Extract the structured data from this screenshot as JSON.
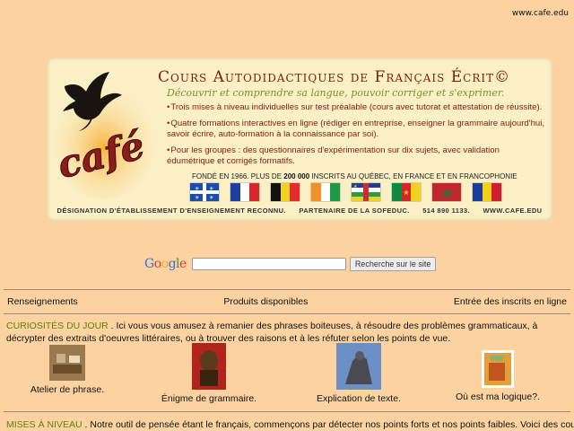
{
  "header": {
    "url": "www.cafe.edu"
  },
  "banner": {
    "logo_text": "café",
    "title": "Cours Autodidactiques de Français Écrit©",
    "subtitle": "Découvrir et comprendre sa langue, pouvoir corriger et s'exprimer.",
    "bullets": [
      "Trois mises à niveau individuelles sur test préalable (cours avec tutorat et attestation de réussite).",
      "Quatre formations interactives en ligne (rédiger en entreprise, enseigner la grammaire aujourd'hui, savoir écrire, auto-formation à la connaissance par soi).",
      "Pour les groupes : des questionnaires d'expérimentation sur dix sujets, avec validation édumétrique et corrigés formatifs."
    ],
    "founded_prefix": "FONDÉ EN 1966. PLUS DE ",
    "founded_count": "200 000",
    "founded_suffix": " INSCRITS AU QUÉBEC, EN FRANCE ET EN FRANCOPHONIE",
    "footer": [
      "DÉSIGNATION D'ÉTABLISSEMENT D'ENSEIGNEMENT RECONNU.",
      "PARTENAIRE DE LA SOFEDUC.",
      "514 890 1133.",
      "WWW.CAFE.EDU"
    ]
  },
  "search": {
    "logo": "Google",
    "placeholder": "",
    "button_label": "Recherche sur le site"
  },
  "nav": {
    "items": [
      "Renseignements",
      "Produits disponibles",
      "Entrée des inscrits en ligne"
    ]
  },
  "curiosites": {
    "heading": "CURIOSITÉS DU JOUR",
    "text": " . Ici vous vous amusez à remanier des phrases boiteuses, à résoudre des problèmes grammaticaux, à décrypter des extraits d'oeuvres littéraires, ou à trouver des raisons et à les réfuter selon les points de vue.",
    "thumbs": [
      {
        "label": "Atelier de phrase."
      },
      {
        "label": "Énigme de grammaire."
      },
      {
        "label": "Explication de texte."
      },
      {
        "label": "Où est ma logique?."
      }
    ]
  },
  "mises": {
    "heading": "MISES À NIVEAU",
    "text": " . Notre outil de pensée étant le français, commençons par détecter nos points forts et nos points faibles. Voici des cours par"
  },
  "colors": {
    "background": "#fcd3a0",
    "banner": "#fbefc6",
    "accent": "#7a1d08",
    "heading_green": "#5c7f0c"
  }
}
